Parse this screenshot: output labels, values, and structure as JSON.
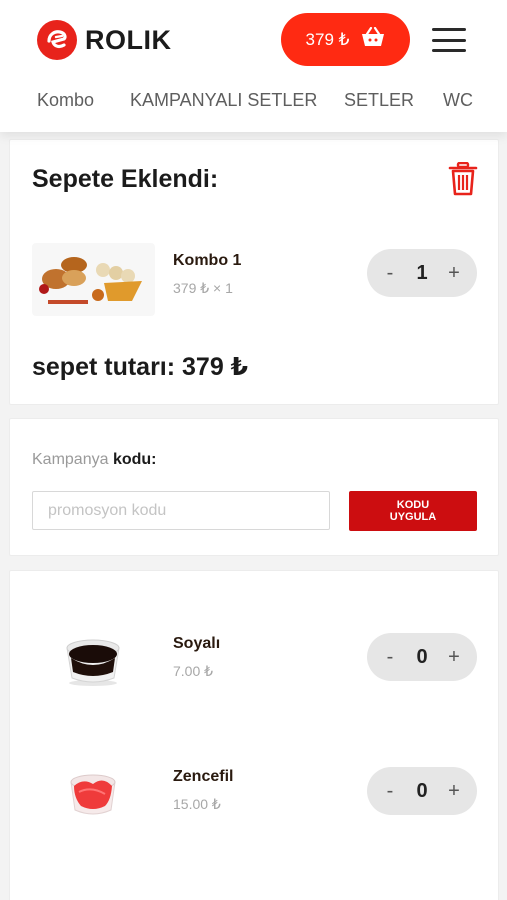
{
  "header": {
    "brand": "ROLIK",
    "cart_total": "379 ₺",
    "brand_color": "#e8231b",
    "cart_color": "#ff2a12"
  },
  "nav": {
    "items": [
      "Kombo",
      "KAMPANYALI SETLER",
      "SETLER",
      "WC"
    ]
  },
  "cart": {
    "title": "Sepete Eklendi:",
    "items": [
      {
        "name": "Kombo 1",
        "detail": "379 ₺ × 1",
        "qty": "1"
      }
    ],
    "total_label": "sepet tutarı: 379 ₺"
  },
  "promo": {
    "label_light": "Kampanya",
    "label_bold": "kodu:",
    "placeholder": "promosyon kodu",
    "button_line1": "KODU",
    "button_line2": "UYGULA",
    "button_color": "#cc0d10"
  },
  "extras": {
    "items": [
      {
        "name": "Soyalı",
        "price": "7.00 ₺",
        "qty": "0"
      },
      {
        "name": "Zencefil",
        "price": "15.00 ₺",
        "qty": "0"
      }
    ]
  },
  "stepper": {
    "minus": "-",
    "plus": "+"
  },
  "icons": {
    "logo": "rolik-logo-icon",
    "basket": "basket-icon",
    "menu": "hamburger-menu-icon",
    "trash": "trash-icon"
  }
}
